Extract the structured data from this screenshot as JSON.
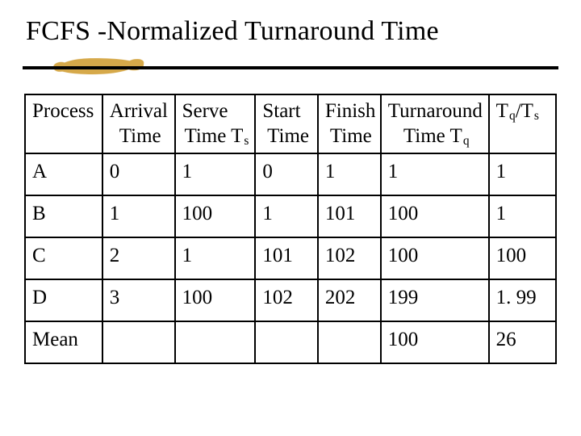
{
  "title": "FCFS -Normalized Turnaround Time",
  "headers": {
    "process": "Process",
    "arrival_top": "Arrival",
    "arrival_bot": "Time",
    "serve_top": "Serve",
    "serve_bot_pre": "Time T",
    "serve_bot_sub": "s",
    "start_top": "Start",
    "start_bot": "Time",
    "finish_top": "Finish",
    "finish_bot": "Time",
    "turn_top": "Turnaround",
    "turn_bot_pre": "Time T",
    "turn_bot_sub": "q",
    "ratio_pre1": "T",
    "ratio_sub1": "q",
    "ratio_mid": "/T",
    "ratio_sub2": "s"
  },
  "rows": [
    {
      "proc": "A",
      "arrival": "0",
      "serve": "1",
      "start": "0",
      "finish": "1",
      "turn": "1",
      "ratio": "1"
    },
    {
      "proc": "B",
      "arrival": "1",
      "serve": "100",
      "start": "1",
      "finish": "101",
      "turn": "100",
      "ratio": "1"
    },
    {
      "proc": "C",
      "arrival": "2",
      "serve": "1",
      "start": "101",
      "finish": "102",
      "turn": "100",
      "ratio": "100"
    },
    {
      "proc": "D",
      "arrival": "3",
      "serve": "100",
      "start": "102",
      "finish": "202",
      "turn": "199",
      "ratio": "1. 99"
    }
  ],
  "mean": {
    "label": "Mean",
    "turn": "100",
    "ratio": "26"
  },
  "chart_data": {
    "type": "table",
    "title": "FCFS - Normalized Turnaround Time",
    "columns": [
      "Process",
      "Arrival Time",
      "Serve Time Ts",
      "Start Time",
      "Finish Time",
      "Turnaround Time Tq",
      "Tq/Ts"
    ],
    "rows": [
      [
        "A",
        0,
        1,
        0,
        1,
        1,
        1
      ],
      [
        "B",
        1,
        100,
        1,
        101,
        100,
        1
      ],
      [
        "C",
        2,
        1,
        101,
        102,
        100,
        100
      ],
      [
        "D",
        3,
        100,
        102,
        202,
        199,
        1.99
      ]
    ],
    "summary": {
      "label": "Mean",
      "Turnaround Time Tq": 100,
      "Tq/Ts": 26
    }
  }
}
